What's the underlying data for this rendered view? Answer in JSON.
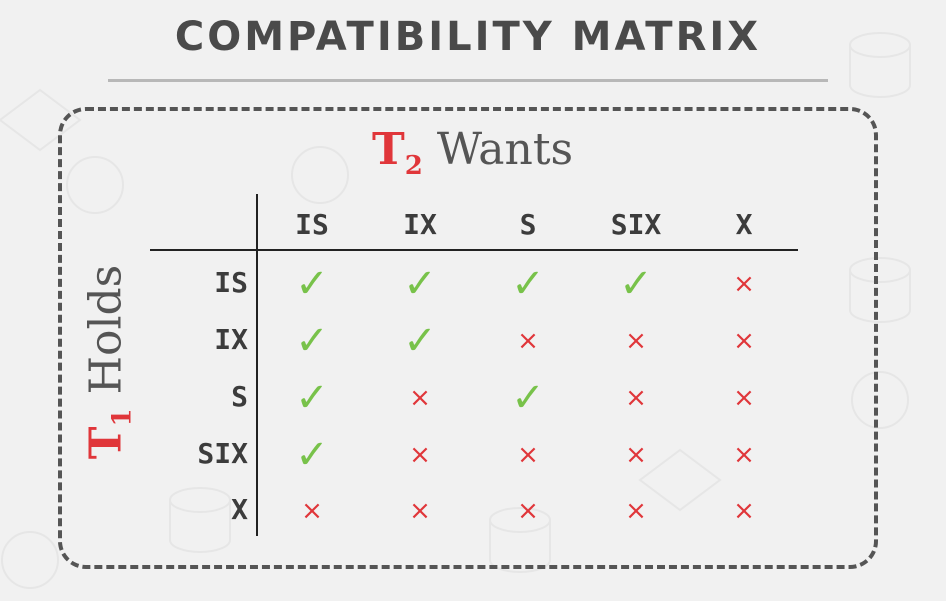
{
  "title": "COMPATIBILITY MATRIX",
  "column_axis": {
    "letter": "T",
    "subscript": "2",
    "label": "Wants"
  },
  "row_axis": {
    "letter": "T",
    "subscript": "1",
    "label": "Holds"
  },
  "symbols": {
    "compatible": "✓",
    "incompatible": "×"
  },
  "colors": {
    "accent_red": "#e0363a",
    "check_green": "#78c24a",
    "text": "#4a4a4a"
  },
  "columns": [
    "IS",
    "IX",
    "S",
    "SIX",
    "X"
  ],
  "rows": [
    {
      "label": "IS",
      "cells": [
        "✓",
        "✓",
        "✓",
        "✓",
        "×"
      ]
    },
    {
      "label": "IX",
      "cells": [
        "✓",
        "✓",
        "×",
        "×",
        "×"
      ]
    },
    {
      "label": "S",
      "cells": [
        "✓",
        "×",
        "✓",
        "×",
        "×"
      ]
    },
    {
      "label": "SIX",
      "cells": [
        "✓",
        "×",
        "×",
        "×",
        "×"
      ]
    },
    {
      "label": "X",
      "cells": [
        "×",
        "×",
        "×",
        "×",
        "×"
      ]
    }
  ]
}
